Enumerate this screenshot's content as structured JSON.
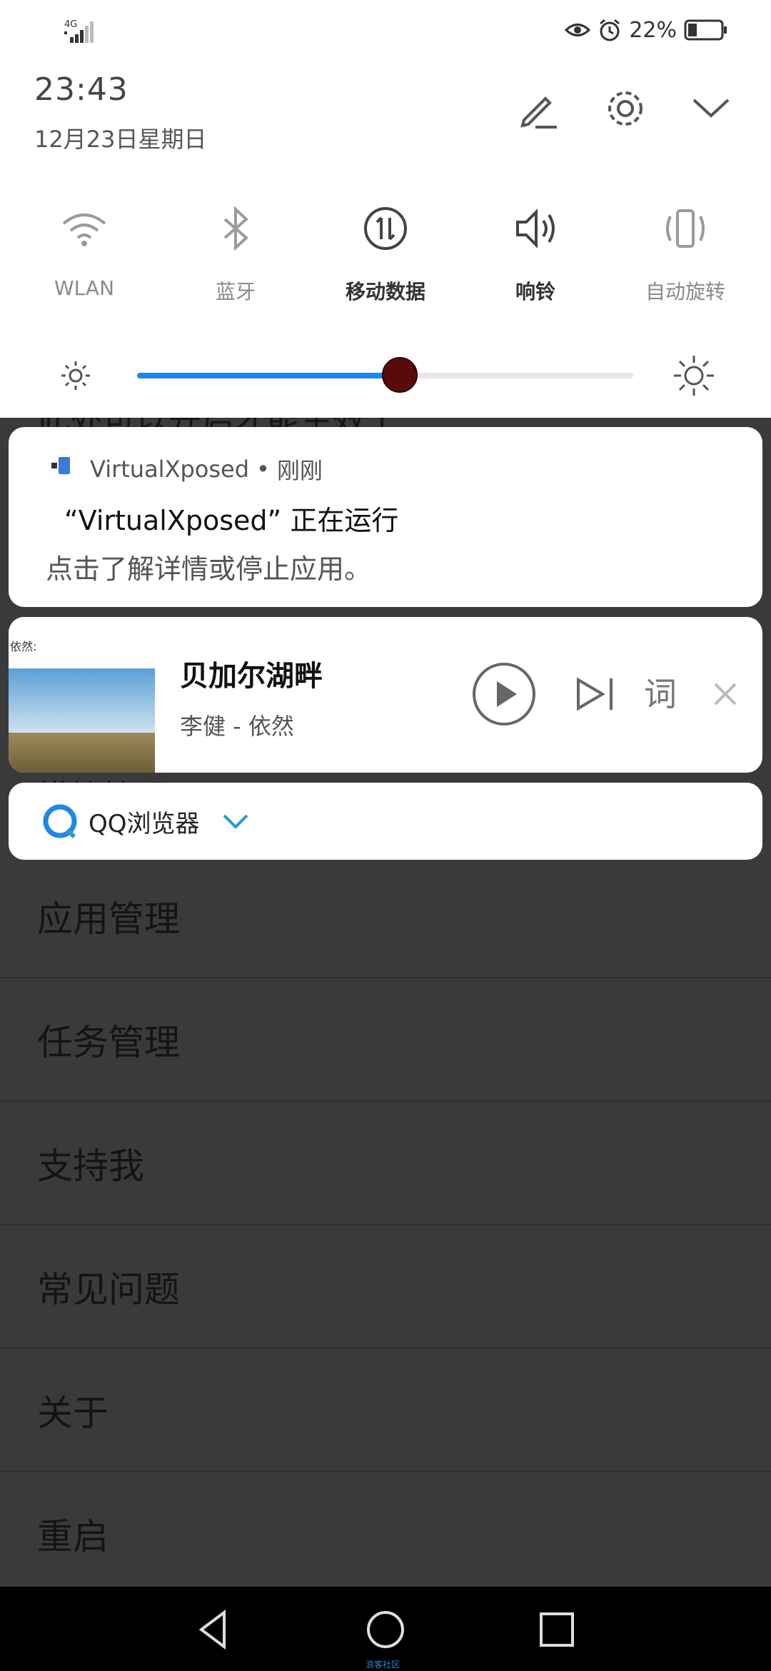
{
  "status_bar": {
    "network": "4G",
    "battery_percent": "22%",
    "icons": [
      "eye-icon",
      "alarm-icon",
      "battery-icon"
    ]
  },
  "header": {
    "time": "23:43",
    "date": "12月23日星期日",
    "actions": [
      "edit-icon",
      "settings-icon",
      "collapse-icon"
    ]
  },
  "quick_settings": [
    {
      "label": "WLAN",
      "icon": "wifi-icon",
      "active": false
    },
    {
      "label": "蓝牙",
      "icon": "bluetooth-icon",
      "active": false
    },
    {
      "label": "移动数据",
      "icon": "mobile-data-icon",
      "active": true
    },
    {
      "label": "响铃",
      "icon": "ring-icon",
      "active": true
    },
    {
      "label": "自动旋转",
      "icon": "auto-rotate-icon",
      "active": false
    }
  ],
  "brightness": {
    "level": 0.53,
    "accent": "#1e88e5"
  },
  "notifications": {
    "virtualxposed": {
      "app": "VirtualXposed",
      "time": "刚刚",
      "separator": "•",
      "title": "“VirtualXposed” 正在运行",
      "body": "点击了解详情或停止应用。"
    },
    "music": {
      "album_caption": "依然:",
      "song": "贝加尔湖畔",
      "artist": "李健 - 依然",
      "lyrics_label": "词",
      "controls": [
        "play-icon",
        "next-icon",
        "close-icon"
      ]
    },
    "qq_browser": {
      "label": "QQ浏览器"
    }
  },
  "background_list": {
    "partial_top": "此处可以开启才能生效了",
    "partial_mid": "模块管理",
    "items": [
      "应用管理",
      "任务管理",
      "支持我",
      "常见问题",
      "关于",
      "重启"
    ]
  },
  "nav_bar": {
    "buttons": [
      "back-icon",
      "home-icon",
      "recents-icon"
    ],
    "watermark": "浪客社区"
  }
}
